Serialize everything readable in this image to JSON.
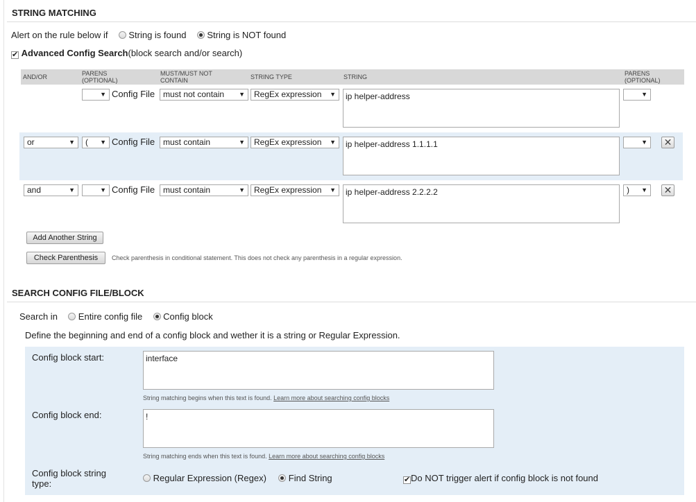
{
  "string_matching": {
    "title": "STRING MATCHING",
    "alert_prefix": "Alert on the rule below if",
    "alert_options": [
      {
        "label": "String is found",
        "checked": false
      },
      {
        "label": "String is NOT found",
        "checked": true
      }
    ],
    "advanced": {
      "checked": true,
      "label_bold": "Advanced Config Search",
      "label_rest": "(block search and/or search)"
    },
    "columns": {
      "andor": "AND/OR",
      "parens_open": "PARENS\n(OPTIONAL)",
      "must": "MUST/MUST NOT\nCONTAIN",
      "string_type": "STRING TYPE",
      "string": "STRING",
      "parens_close": "PARENS\n(OPTIONAL)"
    },
    "rows": [
      {
        "andor": "",
        "paren_open": "",
        "target": "Config File",
        "must": "must not contain",
        "string_type": "RegEx expression",
        "string": "ip helper-address",
        "paren_close": ""
      },
      {
        "andor": "or",
        "paren_open": "(",
        "target": "Config File",
        "must": "must contain",
        "string_type": "RegEx expression",
        "string": "ip helper-address 1.1.1.1",
        "paren_close": ""
      },
      {
        "andor": "and",
        "paren_open": "",
        "target": "Config File",
        "must": "must contain",
        "string_type": "RegEx expression",
        "string": "ip helper-address 2.2.2.2",
        "paren_close": ")"
      }
    ],
    "remove_symbol": "✕",
    "add_button": "Add Another String",
    "check_button": "Check Parenthesis",
    "check_note": "Check parenthesis in conditional statement. This does not check any parenthesis in a regular expression."
  },
  "search_block": {
    "title": "SEARCH CONFIG FILE/BLOCK",
    "search_in_label": "Search in",
    "search_in_options": [
      {
        "label": "Entire config file",
        "checked": false
      },
      {
        "label": "Config block",
        "checked": true
      }
    ],
    "define_text": "Define the beginning and end of a config block and wether it is a string or Regular Expression.",
    "start_label": "Config block start:",
    "start_value": "interface",
    "start_note": "String matching begins when this text is found.",
    "end_label": "Config block end:",
    "end_value": "!",
    "end_note": "String matching ends when this text is found.",
    "learn_more": "Learn more about searching config blocks",
    "type_label_line1": "Config block string",
    "type_label_line2": "type:",
    "type_options": [
      {
        "label": "Regular Expression (Regex)",
        "checked": false
      },
      {
        "label": "Find String",
        "checked": true
      }
    ],
    "no_trigger": {
      "checked": true,
      "label": "Do NOT trigger alert if config block is not found"
    }
  },
  "colors": {
    "row_highlight": "#e4eef7",
    "header_bg": "#d8d8d8"
  },
  "icons": {
    "dropdown": "▼",
    "check": "✔"
  }
}
